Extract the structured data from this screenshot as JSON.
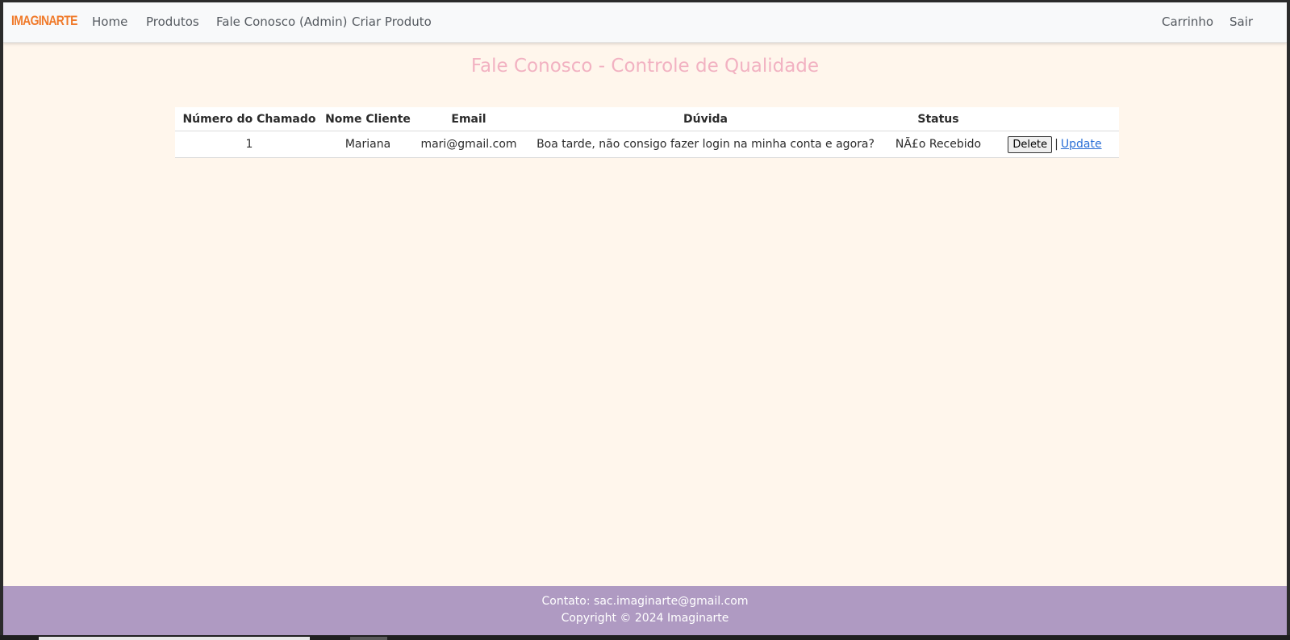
{
  "navbar": {
    "brand": "IMAGINARTE",
    "links": [
      "Home",
      "Produtos",
      "Fale Conosco (Admin)",
      "Criar Produto"
    ],
    "right_links": [
      "Carrinho",
      "Sair"
    ]
  },
  "page": {
    "title": "Fale Conosco - Controle de Qualidade"
  },
  "table": {
    "headers": [
      "Número do Chamado",
      "Nome Cliente",
      "Email",
      "Dúvida",
      "Status",
      ""
    ],
    "rows": [
      {
        "numero": "1",
        "nome": "Mariana",
        "email": "mari@gmail.com",
        "duvida": "Boa tarde, não consigo fazer login na minha conta e agora?",
        "status": "NÃ£o Recebido",
        "delete_label": "Delete",
        "separator": "|",
        "update_label": "Update"
      }
    ]
  },
  "footer": {
    "contact": "Contato: sac.imaginarte@gmail.com",
    "copyright": "Copyright © 2024 Imaginarte"
  },
  "colors": {
    "brand": "#f07a2a",
    "title": "#f2b2c2",
    "background": "#fff6ec",
    "footer": "#af9ac2",
    "link": "#2a6fd6"
  }
}
